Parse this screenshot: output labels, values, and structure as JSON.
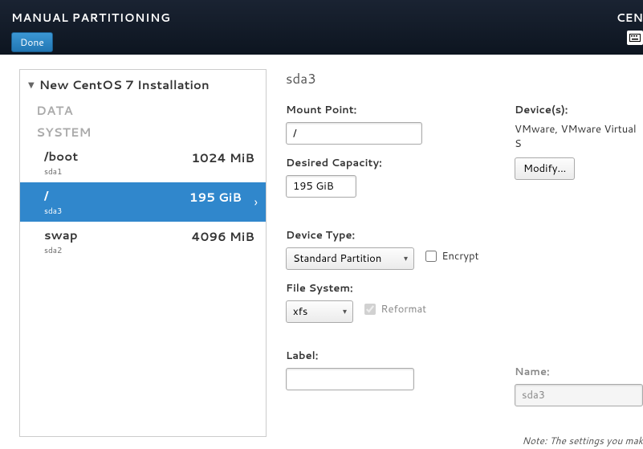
{
  "header": {
    "title": "MANUAL PARTITIONING",
    "right_text": "CEN",
    "done": "Done"
  },
  "tree": {
    "title": "New CentOS 7 Installation",
    "data_label": "DATA",
    "system_label": "SYSTEM",
    "partitions": [
      {
        "name": "/boot",
        "device": "sda1",
        "size": "1024 MiB"
      },
      {
        "name": "/",
        "device": "sda3",
        "size": "195 GiB"
      },
      {
        "name": "swap",
        "device": "sda2",
        "size": "4096 MiB"
      }
    ]
  },
  "detail": {
    "title": "sda3",
    "mount_point_label": "Mount Point:",
    "mount_point": "/",
    "desired_capacity_label": "Desired Capacity:",
    "desired_capacity": "195 GiB",
    "device_type_label": "Device Type:",
    "device_type": "Standard Partition",
    "encrypt_label": "Encrypt",
    "file_system_label": "File System:",
    "file_system": "xfs",
    "reformat_label": "Reformat",
    "label_label": "Label:",
    "label_value": "",
    "devices_label": "Device(s):",
    "devices_text": "VMware, VMware Virtual S",
    "modify": "Modify...",
    "name_label": "Name:",
    "name_value": "sda3"
  },
  "note": "Note:  The settings you mak"
}
